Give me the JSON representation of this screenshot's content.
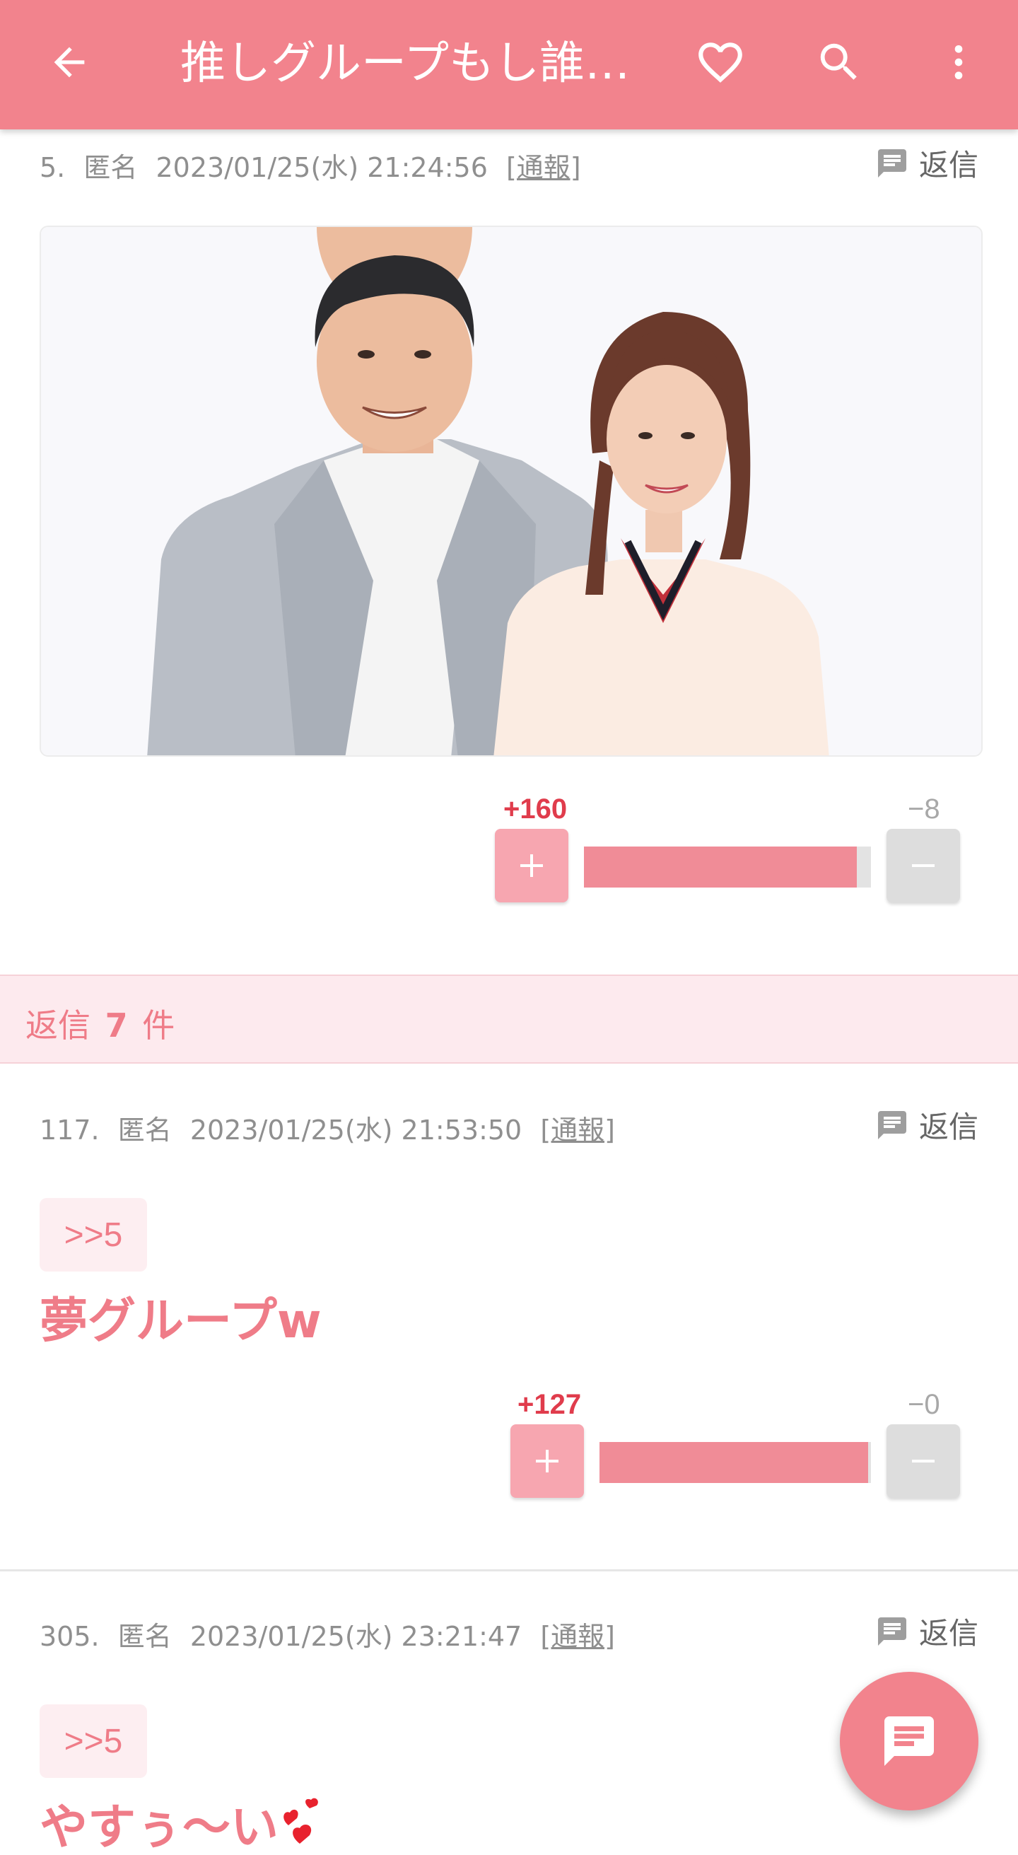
{
  "appbar": {
    "title": "推しグループもし誰…",
    "back_icon": "arrow-left-icon",
    "favorite_icon": "heart-outline-icon",
    "search_icon": "search-icon",
    "menu_icon": "more-vertical-icon",
    "color": "#f2838d"
  },
  "comments": [
    {
      "number": "5.",
      "author": "匿名",
      "datetime": "2023/01/25(水) 21:24:56",
      "report_label": "[通報]",
      "reply_label": "返信",
      "plus_count": "+160",
      "minus_count": "−8",
      "plus_ratio": 0.95
    },
    {
      "number": "117.",
      "author": "匿名",
      "datetime": "2023/01/25(水) 21:53:50",
      "report_label": "[通報]",
      "reply_label": "返信",
      "anchor": ">>5",
      "text": "夢グループw",
      "plus_count": "+127",
      "minus_count": "−0",
      "plus_ratio": 0.99
    },
    {
      "number": "305.",
      "author": "匿名",
      "datetime": "2023/01/25(水) 23:21:47",
      "report_label": "[通報]",
      "reply_label": "返信",
      "anchor": ">>5",
      "text": "やすぅ〜い"
    }
  ],
  "replies_section": {
    "prefix": "返信",
    "count": "7",
    "suffix": "件"
  },
  "fab": {
    "icon": "comment-icon"
  },
  "colors": {
    "accent": "#f2838d",
    "text_pink": "#ef7c88",
    "plus_red": "#e03c4c",
    "bar_fill": "#f08c97"
  }
}
